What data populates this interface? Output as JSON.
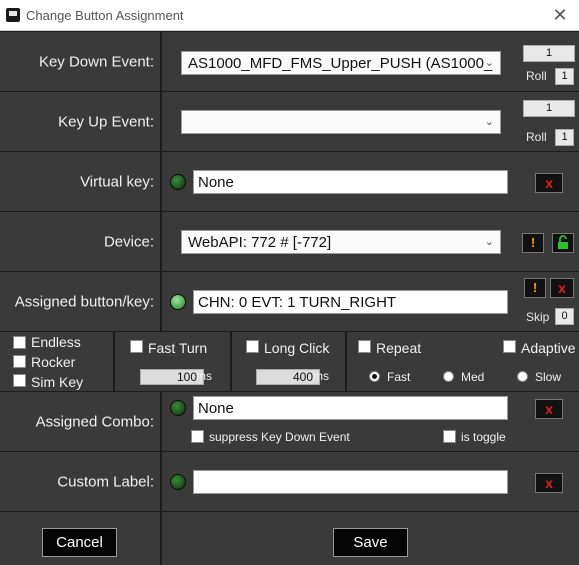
{
  "window": {
    "title": "Change Button Assignment"
  },
  "key_down": {
    "label": "Key Down Event:",
    "value": "AS1000_MFD_FMS_Upper_PUSH (AS1000_",
    "count": "1",
    "roll_label": "Roll",
    "roll_value": "1"
  },
  "key_up": {
    "label": "Key Up Event:",
    "value": "",
    "count": "1",
    "roll_label": "Roll",
    "roll_value": "1"
  },
  "virtual_key": {
    "label": "Virtual key:",
    "value": "None",
    "clear": "x"
  },
  "device": {
    "label": "Device:",
    "value": "WebAPI: 772 # [-772]",
    "warn": "!"
  },
  "assigned": {
    "label": "Assigned button/key:",
    "value": "CHN: 0 EVT: 1 TURN_RIGHT",
    "warn": "!",
    "clear": "x",
    "skip_label": "Skip",
    "skip_value": "0"
  },
  "options": {
    "endless": "Endless",
    "rocker": "Rocker",
    "sim_key": "Sim Key",
    "fast_turn": "Fast Turn",
    "fast_turn_ms": "100",
    "long_click": "Long Click",
    "long_click_ms": "400",
    "ms": "ms",
    "repeat": "Repeat",
    "adaptive": "Adaptive",
    "speed_fast": "Fast",
    "speed_med": "Med",
    "speed_slow": "Slow"
  },
  "combo": {
    "label": "Assigned Combo:",
    "value": "None",
    "clear": "x",
    "suppress": "suppress Key Down Event",
    "is_toggle": "is toggle"
  },
  "custom_label": {
    "label": "Custom Label:",
    "value": "",
    "clear": "x"
  },
  "buttons": {
    "cancel": "Cancel",
    "save": "Save"
  },
  "icons": {
    "dropdown": "chevron-down-icon",
    "close": "close-icon",
    "lock": "lock-icon",
    "led": "status-led-icon"
  },
  "colors": {
    "panel": "#3a3a3a",
    "led_green": "#56a856",
    "clear_red": "#e02020",
    "warn_orange": "#f0a000"
  }
}
